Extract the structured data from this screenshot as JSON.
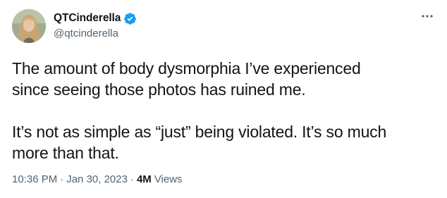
{
  "author": {
    "display_name": "QTCinderella",
    "handle": "@qtcinderella",
    "verified": true
  },
  "tweet": {
    "paragraphs": [
      "The amount of body dysmorphia I’ve experienced\nsince seeing those photos has ruined me.",
      "It’s not as simple as “just” being violated. It’s so much\nmore than that."
    ]
  },
  "meta": {
    "time": "10:36 PM",
    "separator": "·",
    "date": "Jan 30, 2023",
    "views_count": "4M",
    "views_label": "Views"
  },
  "icons": {
    "verified": "verified-badge-icon",
    "more": "more-options-icon"
  },
  "colors": {
    "text_primary": "#0f1419",
    "text_secondary": "#536471",
    "verified_blue": "#1d9bf0"
  }
}
